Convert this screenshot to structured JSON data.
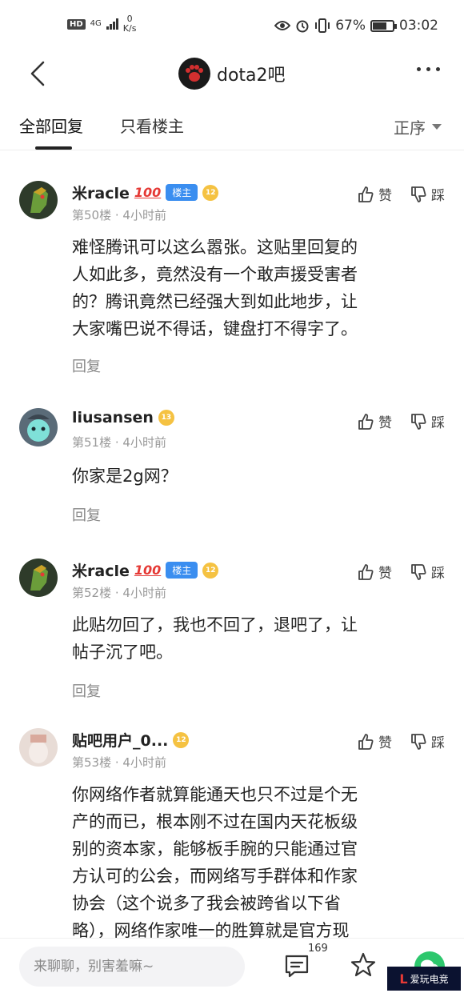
{
  "status_bar": {
    "hd": "HD",
    "network": "4G",
    "speed_value": "0",
    "speed_unit": "K/s",
    "battery": "67%",
    "battery_level": 0.67,
    "time": "03:02"
  },
  "nav": {
    "forum_name": "dota2吧"
  },
  "tabs": {
    "all_replies": "全部回复",
    "owner_only": "只看楼主",
    "sort": "正序"
  },
  "posts": [
    {
      "username": "米racle",
      "emoji": "💯",
      "owner_badge": "楼主",
      "level": "12",
      "floor": "第50楼",
      "time": "4小时前",
      "like": "赞",
      "dislike": "踩",
      "content_lines": [
        "难怪腾讯可以这么嚣张。这贴里回复的",
        "人如此多，竟然没有一个敢声援受害者",
        "的？腾讯竟然已经强大到如此地步，让",
        "大家嘴巴说不得话，键盘打不得字了。"
      ],
      "reply": "回复"
    },
    {
      "username": "liusansen",
      "level": "13",
      "floor": "第51楼",
      "time": "4小时前",
      "like": "赞",
      "dislike": "踩",
      "content_lines": [
        "你家是2g网？"
      ],
      "reply": "回复"
    },
    {
      "username": "米racle",
      "emoji": "💯",
      "owner_badge": "楼主",
      "level": "12",
      "floor": "第52楼",
      "time": "4小时前",
      "like": "赞",
      "dislike": "踩",
      "content_lines": [
        "此贴勿回了，我也不回了，退吧了，让",
        "帖子沉了吧。"
      ],
      "reply": "回复"
    },
    {
      "username": "贴吧用户_0...",
      "level": "12",
      "floor": "第53楼",
      "time": "4小时前",
      "like": "赞",
      "dislike": "踩",
      "content_lines": [
        "你网络作者就算能通天也只不过是个无",
        "产的而已，根本刚不过在国内天花板级",
        "别的资本家，能够板手腕的只能通过官",
        "方认可的公会，而网络写手群体和作家",
        "协会（这个说多了我会被跨省以下省",
        "略），网络作家唯一的胜算就是官方现"
      ]
    }
  ],
  "bottom_bar": {
    "input_placeholder": "来聊聊，别害羞嘛~",
    "comment_count": "169",
    "watermark": "爱玩电竞"
  },
  "colors": {
    "owner_badge": "#3a8ef0",
    "level_badge": "#f5c242",
    "share_green": "#2dc76d"
  }
}
